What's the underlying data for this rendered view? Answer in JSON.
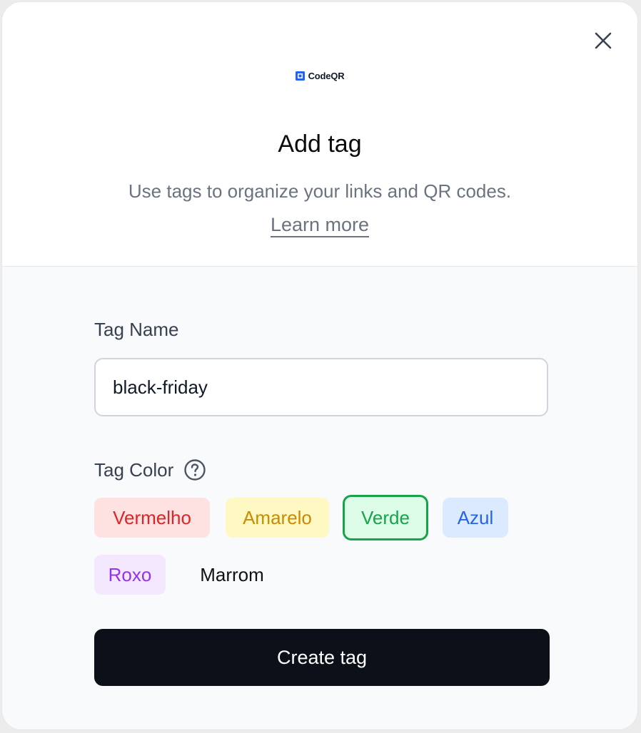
{
  "brand": {
    "logo_text": "CodeQR",
    "accent_color": "#2563eb"
  },
  "header": {
    "close_icon": "close-icon",
    "title": "Add tag",
    "subtitle": "Use tags to organize your links and QR codes.",
    "learn_more": "Learn more"
  },
  "form": {
    "name_label": "Tag Name",
    "name_value": "black-friday",
    "color_label": "Tag Color",
    "help_icon": "question-circle-icon",
    "colors": [
      {
        "label": "Vermelho",
        "bg": "#fee2e2",
        "fg": "#dc2626"
      },
      {
        "label": "Amarelo",
        "bg": "#fef9c3",
        "fg": "#ca8a04"
      },
      {
        "label": "Verde",
        "bg": "#dcfce7",
        "fg": "#16a34a",
        "selected": true
      },
      {
        "label": "Azul",
        "bg": "#dbeafe",
        "fg": "#2563eb"
      },
      {
        "label": "Roxo",
        "bg": "#f3e8ff",
        "fg": "#9333ea"
      },
      {
        "label": "Marrom",
        "bg": "transparent",
        "fg": "#111111"
      }
    ],
    "submit_label": "Create tag",
    "submit_color": "#0c1119"
  }
}
